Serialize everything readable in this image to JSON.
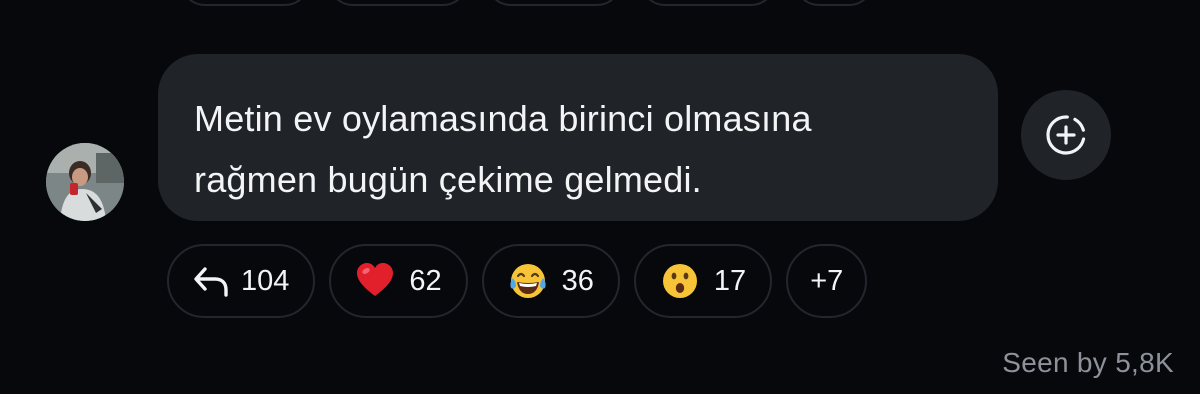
{
  "message": {
    "lines": [
      "Metin ev oylamasında birinci olmasına",
      "rağmen bugün çekime gelmedi."
    ]
  },
  "reactions": [
    {
      "icon": "reply-arrow-icon",
      "count": "104"
    },
    {
      "icon": "red-heart-emoji",
      "count": "62"
    },
    {
      "icon": "tears-of-joy-emoji",
      "count": "36"
    },
    {
      "icon": "surprised-face-emoji",
      "count": "17"
    }
  ],
  "more_reactions": "+7",
  "seen_by": "Seen by 5,8K",
  "colors": {
    "background": "#06080c",
    "bubble": "#202327",
    "pill_border": "#22262d",
    "muted_text": "#8d9199"
  }
}
